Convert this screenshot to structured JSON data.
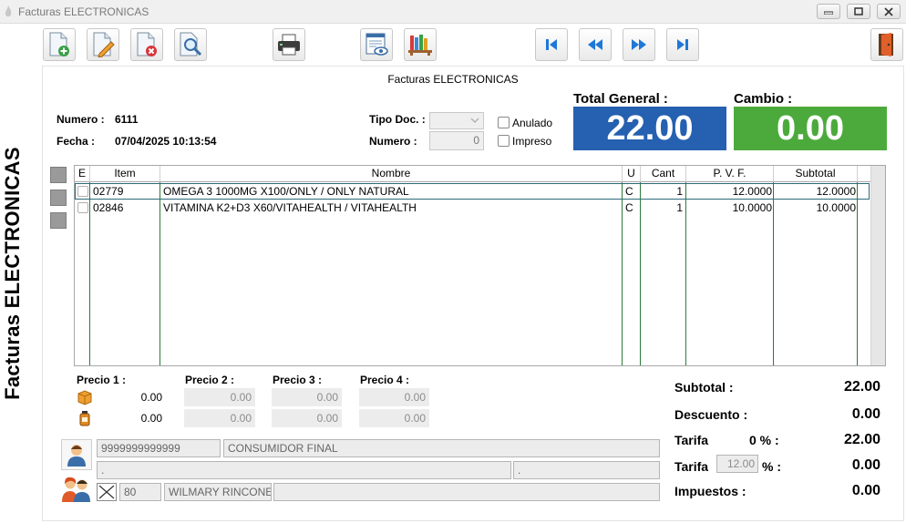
{
  "window": {
    "title": "Facturas ELECTRONICAS"
  },
  "side_title": "Facturas ELECTRONICAS",
  "panel_title": "Facturas ELECTRONICAS",
  "toolbar": {
    "icons": [
      "new-doc-icon",
      "edit-doc-icon",
      "delete-doc-icon",
      "search-doc-icon",
      "printer-icon",
      "preview-icon",
      "library-icon",
      "first-record-icon",
      "previous-record-icon",
      "next-record-icon",
      "last-record-icon",
      "exit-door-icon"
    ]
  },
  "header": {
    "numero_label": "Numero :",
    "numero_value": "6111",
    "fecha_label": "Fecha :",
    "fecha_value": "07/04/2025 10:13:54",
    "tipo_doc_label": "Tipo Doc. :",
    "tipo_doc_value": "",
    "doc_numero_label": "Numero :",
    "doc_numero_value": "0",
    "anulado_label": "Anulado",
    "impreso_label": "Impreso"
  },
  "totals_header": {
    "total_general_label": "Total General  :",
    "total_general_value": "22.00",
    "total_general_color": "#2660b0",
    "cambio_label": "Cambio :",
    "cambio_value": "0.00",
    "cambio_color": "#4caa3c"
  },
  "grid": {
    "columns": [
      "E",
      "Item",
      "Nombre",
      "U",
      "Cant",
      "P. V. F.",
      "Subtotal"
    ],
    "rows": [
      {
        "item": "02779",
        "nombre": "OMEGA 3 1000MG X100/ONLY / ONLY NATURAL",
        "u": "C",
        "cant": "1",
        "pvf": "12.0000",
        "subtotal": "12.0000"
      },
      {
        "item": "02846",
        "nombre": "VITAMINA K2+D3 X60/VITAHEALTH / VITAHEALTH",
        "u": "C",
        "cant": "1",
        "pvf": "10.0000",
        "subtotal": "10.0000"
      }
    ]
  },
  "prices": {
    "labels": [
      "Precio 1 :",
      "Precio 2 :",
      "Precio 3 :",
      "Precio 4 :"
    ],
    "row1": [
      "0.00",
      "0.00",
      "0.00",
      "0.00"
    ],
    "row2": [
      "0.00",
      "0.00",
      "0.00",
      "0.00"
    ]
  },
  "customer": {
    "id": "9999999999999",
    "name": "CONSUMIDOR FINAL",
    "address": ".",
    "phone": ".",
    "seller_code": "80",
    "seller_name": "WILMARY RINCONE",
    "seller_extra": ""
  },
  "summary": {
    "subtotal_label": "Subtotal :",
    "subtotal_value": "22.00",
    "descuento_label": "Descuento :",
    "descuento_value": "0.00",
    "tarifa0_label": "Tarifa",
    "tarifa0_pct": "0 % :",
    "tarifa0_value": "22.00",
    "tarifa_label": "Tarifa",
    "tarifa_rate": "12.00",
    "tarifa_pct": "% :",
    "tarifa_value": "0.00",
    "impuestos_label": "Impuestos :",
    "impuestos_value": "0.00"
  }
}
